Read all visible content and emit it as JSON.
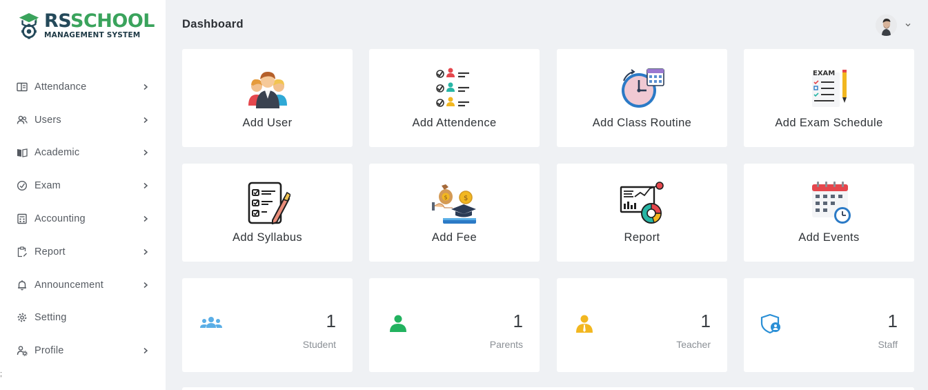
{
  "brand": {
    "title_part1": "RS",
    "title_part2": "SCHOOL",
    "subtitle": "MANAGEMENT SYSTEM",
    "color_primary": "#24495a",
    "color_accent": "#3aa35c"
  },
  "sidebar": {
    "items": [
      {
        "label": "Attendance",
        "icon": "id-card-icon",
        "has_submenu": true
      },
      {
        "label": "Users",
        "icon": "users-icon",
        "has_submenu": true
      },
      {
        "label": "Academic",
        "icon": "book-open-icon",
        "has_submenu": true
      },
      {
        "label": "Exam",
        "icon": "circle-check-icon",
        "has_submenu": true
      },
      {
        "label": "Accounting",
        "icon": "calculator-icon",
        "has_submenu": true
      },
      {
        "label": "Report",
        "icon": "clipboard-edit-icon",
        "has_submenu": true
      },
      {
        "label": "Announcement",
        "icon": "bell-icon",
        "has_submenu": true
      },
      {
        "label": "Setting",
        "icon": "gear-icon",
        "has_submenu": false
      },
      {
        "label": "Profile",
        "icon": "user-gear-icon",
        "has_submenu": true
      }
    ],
    "stray_text": ";"
  },
  "header": {
    "title": "Dashboard",
    "avatar": "user-avatar"
  },
  "actions": [
    {
      "label": "Add User",
      "icon": "people-group-icon"
    },
    {
      "label": "Add Attendence",
      "icon": "checklist-people-icon"
    },
    {
      "label": "Add Class Routine",
      "icon": "clock-calendar-icon"
    },
    {
      "label": "Add Exam Schedule",
      "icon": "exam-sheet-icon"
    },
    {
      "label": "Add Syllabus",
      "icon": "checklist-pencil-icon"
    },
    {
      "label": "Add Fee",
      "icon": "money-graduation-icon"
    },
    {
      "label": "Report",
      "icon": "analytics-report-icon"
    },
    {
      "label": "Add Events",
      "icon": "calendar-clock-icon"
    }
  ],
  "stats": [
    {
      "value": "1",
      "label": "Student",
      "icon": "users-group-icon",
      "color": "#5aaee6"
    },
    {
      "value": "1",
      "label": "Parents",
      "icon": "user-icon",
      "color": "#22b25f"
    },
    {
      "value": "1",
      "label": "Teacher",
      "icon": "user-tie-icon",
      "color": "#f2b720"
    },
    {
      "value": "1",
      "label": "Staff",
      "icon": "user-shield-icon",
      "color": "#2a8fd6"
    }
  ]
}
